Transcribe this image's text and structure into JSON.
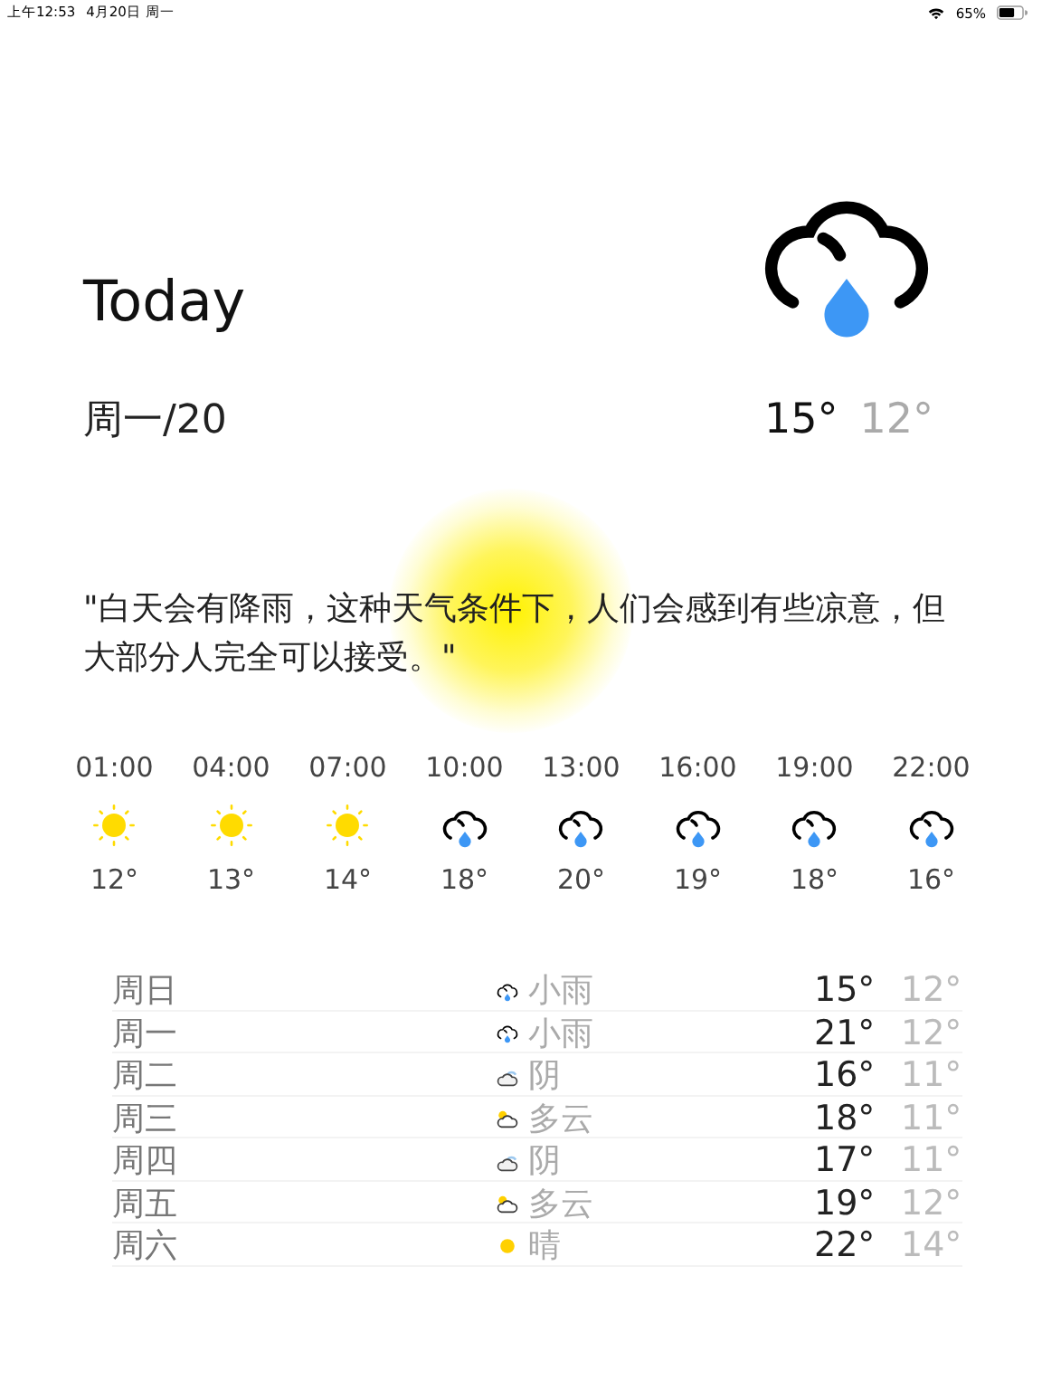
{
  "status_bar": {
    "time": "上午12:53",
    "date": "4月20日 周一",
    "battery": "65%"
  },
  "today": {
    "title": "Today",
    "date": "周一/20",
    "kind": "rain",
    "high": "15°",
    "low": "12°"
  },
  "quote": "\"白天会有降雨，这种天气条件下，人们会感到有些凉意，但大部分人完全可以接受。\"",
  "hourly": [
    {
      "time": "01:00",
      "kind": "sun",
      "temp": "12°"
    },
    {
      "time": "04:00",
      "kind": "sun",
      "temp": "13°"
    },
    {
      "time": "07:00",
      "kind": "sun",
      "temp": "14°"
    },
    {
      "time": "10:00",
      "kind": "rain",
      "temp": "18°"
    },
    {
      "time": "13:00",
      "kind": "rain",
      "temp": "20°"
    },
    {
      "time": "16:00",
      "kind": "rain",
      "temp": "19°"
    },
    {
      "time": "19:00",
      "kind": "rain",
      "temp": "18°"
    },
    {
      "time": "22:00",
      "kind": "rain",
      "temp": "16°"
    }
  ],
  "daily": [
    {
      "day": "周日",
      "kind": "rain",
      "text": "小雨",
      "high": "15°",
      "low": "12°"
    },
    {
      "day": "周一",
      "kind": "rain",
      "text": "小雨",
      "high": "21°",
      "low": "12°"
    },
    {
      "day": "周二",
      "kind": "overcast",
      "text": "阴",
      "high": "16°",
      "low": "11°"
    },
    {
      "day": "周三",
      "kind": "partly-cloudy",
      "text": "多云",
      "high": "18°",
      "low": "11°"
    },
    {
      "day": "周四",
      "kind": "overcast",
      "text": "阴",
      "high": "17°",
      "low": "11°"
    },
    {
      "day": "周五",
      "kind": "partly-cloudy",
      "text": "多云",
      "high": "19°",
      "low": "12°"
    },
    {
      "day": "周六",
      "kind": "sun",
      "text": "晴",
      "high": "22°",
      "low": "14°"
    }
  ]
}
